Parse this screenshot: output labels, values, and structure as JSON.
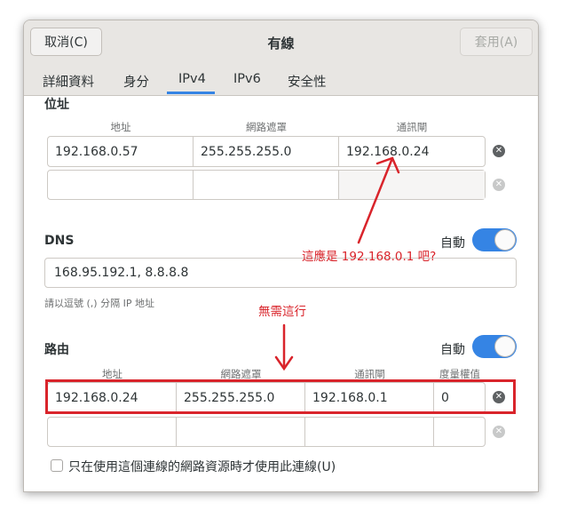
{
  "header": {
    "title": "有線",
    "cancel_label": "取消(C)",
    "apply_label": "套用(A)"
  },
  "tabs": [
    {
      "label": "詳細資料"
    },
    {
      "label": "身分"
    },
    {
      "label": "IPv4"
    },
    {
      "label": "IPv6"
    },
    {
      "label": "安全性"
    }
  ],
  "active_tab": "IPv4",
  "address": {
    "section_title": "位址",
    "columns": [
      "地址",
      "網路遮罩",
      "通訊閘"
    ],
    "rows": [
      [
        "192.168.0.57",
        "255.255.255.0",
        "192.168.0.24"
      ],
      [
        "",
        "",
        ""
      ]
    ]
  },
  "dns": {
    "section_title": "DNS",
    "auto_label": "自動",
    "auto_enabled": true,
    "value": "168.95.192.1, 8.8.8.8",
    "hint": "請以逗號 (,) 分隔 IP 地址"
  },
  "routes": {
    "section_title": "路由",
    "auto_label": "自動",
    "auto_enabled": true,
    "columns": [
      "地址",
      "網路遮罩",
      "通訊閘",
      "度量權值"
    ],
    "rows": [
      [
        "192.168.0.24",
        "255.255.255.0",
        "192.168.0.1",
        "0"
      ],
      [
        "",
        "",
        "",
        ""
      ]
    ]
  },
  "only_local_label": "只在使用這個連線的網路資源時才使用此連線(U)",
  "annotations": {
    "gateway_note": "這應是 192.168.0.1 吧?",
    "route_note": "無需這行"
  },
  "colors": {
    "accent": "#3584e4",
    "annotation": "#d9242b"
  }
}
